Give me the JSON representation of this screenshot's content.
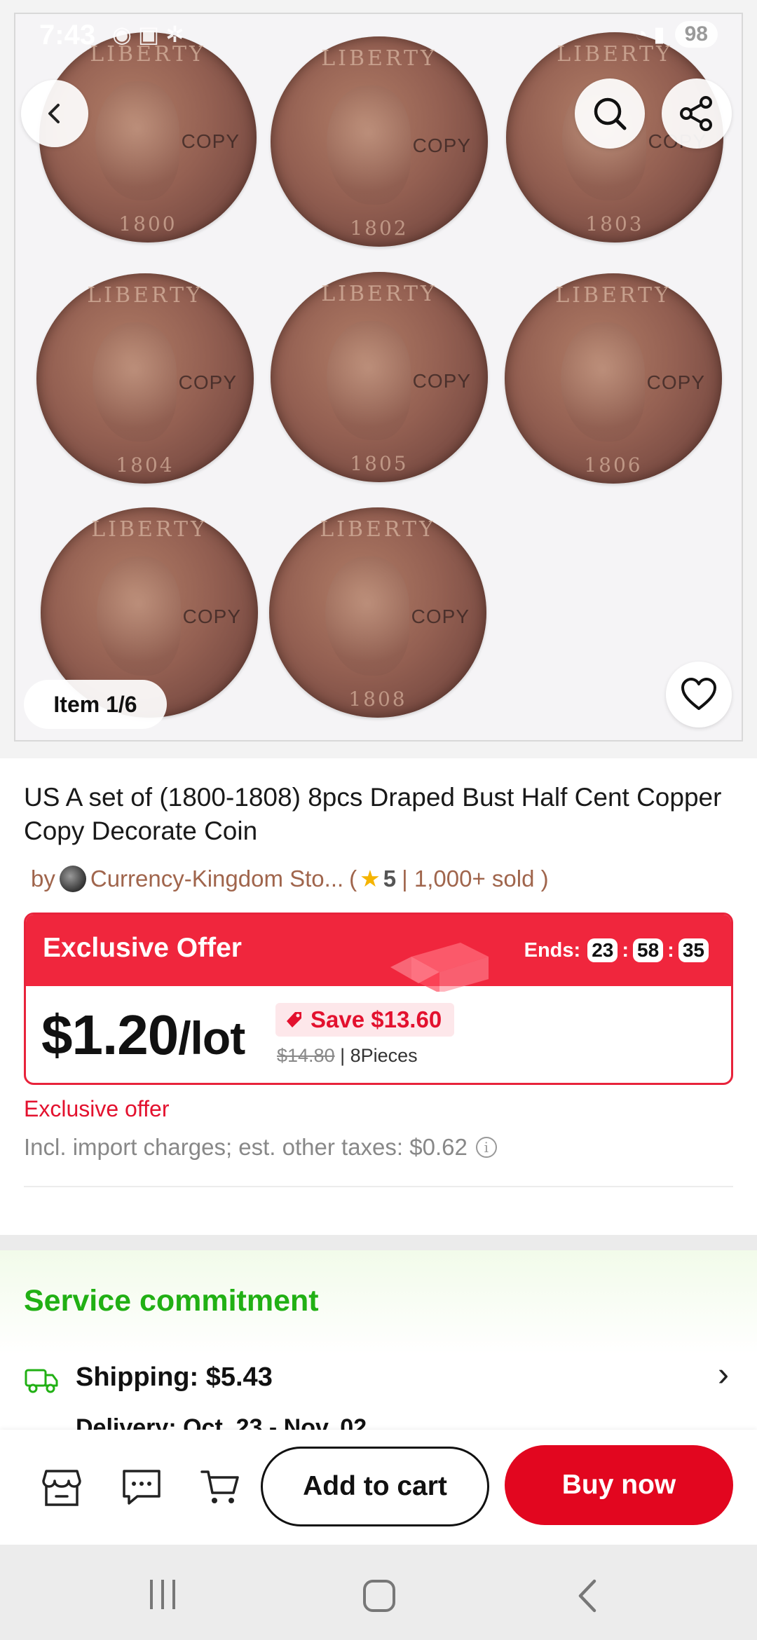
{
  "status_bar": {
    "time": "7:43",
    "icons": "◉ ▣ ✲",
    "right_icons": "◔ ▮",
    "battery": "98"
  },
  "gallery": {
    "item_counter": "Item 1/6",
    "coin_labels": {
      "legend": "LIBERTY",
      "overlay": "COPY"
    },
    "coin_years": [
      "1800",
      "1802",
      "1803",
      "1804",
      "1805",
      "1806",
      "",
      "1808"
    ]
  },
  "product": {
    "title": "US A set of (1800-1808) 8pcs Draped Bust Half Cent Copper Copy Decorate Coin",
    "seller": {
      "prefix": "by",
      "name": "Currency-Kingdom Sto...",
      "open_paren": "(",
      "rating": "5",
      "sold": "| 1,000+ sold )"
    }
  },
  "offer": {
    "title": "Exclusive Offer",
    "ends_label": "Ends:",
    "hours": "23",
    "minutes": "58",
    "seconds": "35",
    "price": "$1.20",
    "price_unit": "/lot",
    "save": "Save $13.60",
    "original_price": "$14.80",
    "pieces": "| 8Pieces"
  },
  "notes": {
    "exclusive": "Exclusive offer",
    "taxes": "Incl. import charges; est. other taxes: $0.62",
    "info_glyph": "i"
  },
  "service": {
    "title": "Service commitment",
    "shipping": "Shipping: $5.43",
    "delivery": "Delivery: Oct. 23 - Nov. 02"
  },
  "actions": {
    "add_to_cart": "Add to cart",
    "buy_now": "Buy now"
  },
  "colors": {
    "accent_red": "#e2061f",
    "offer_red": "#f0263d",
    "service_green": "#21b014",
    "seller_brown": "#a0654c"
  },
  "icons": {
    "back": "chevron-left-icon",
    "search": "search-icon",
    "share": "share-icon",
    "wishlist": "heart-icon",
    "store": "store-icon",
    "message": "chat-icon",
    "cart": "cart-icon",
    "shipping": "truck-icon"
  }
}
